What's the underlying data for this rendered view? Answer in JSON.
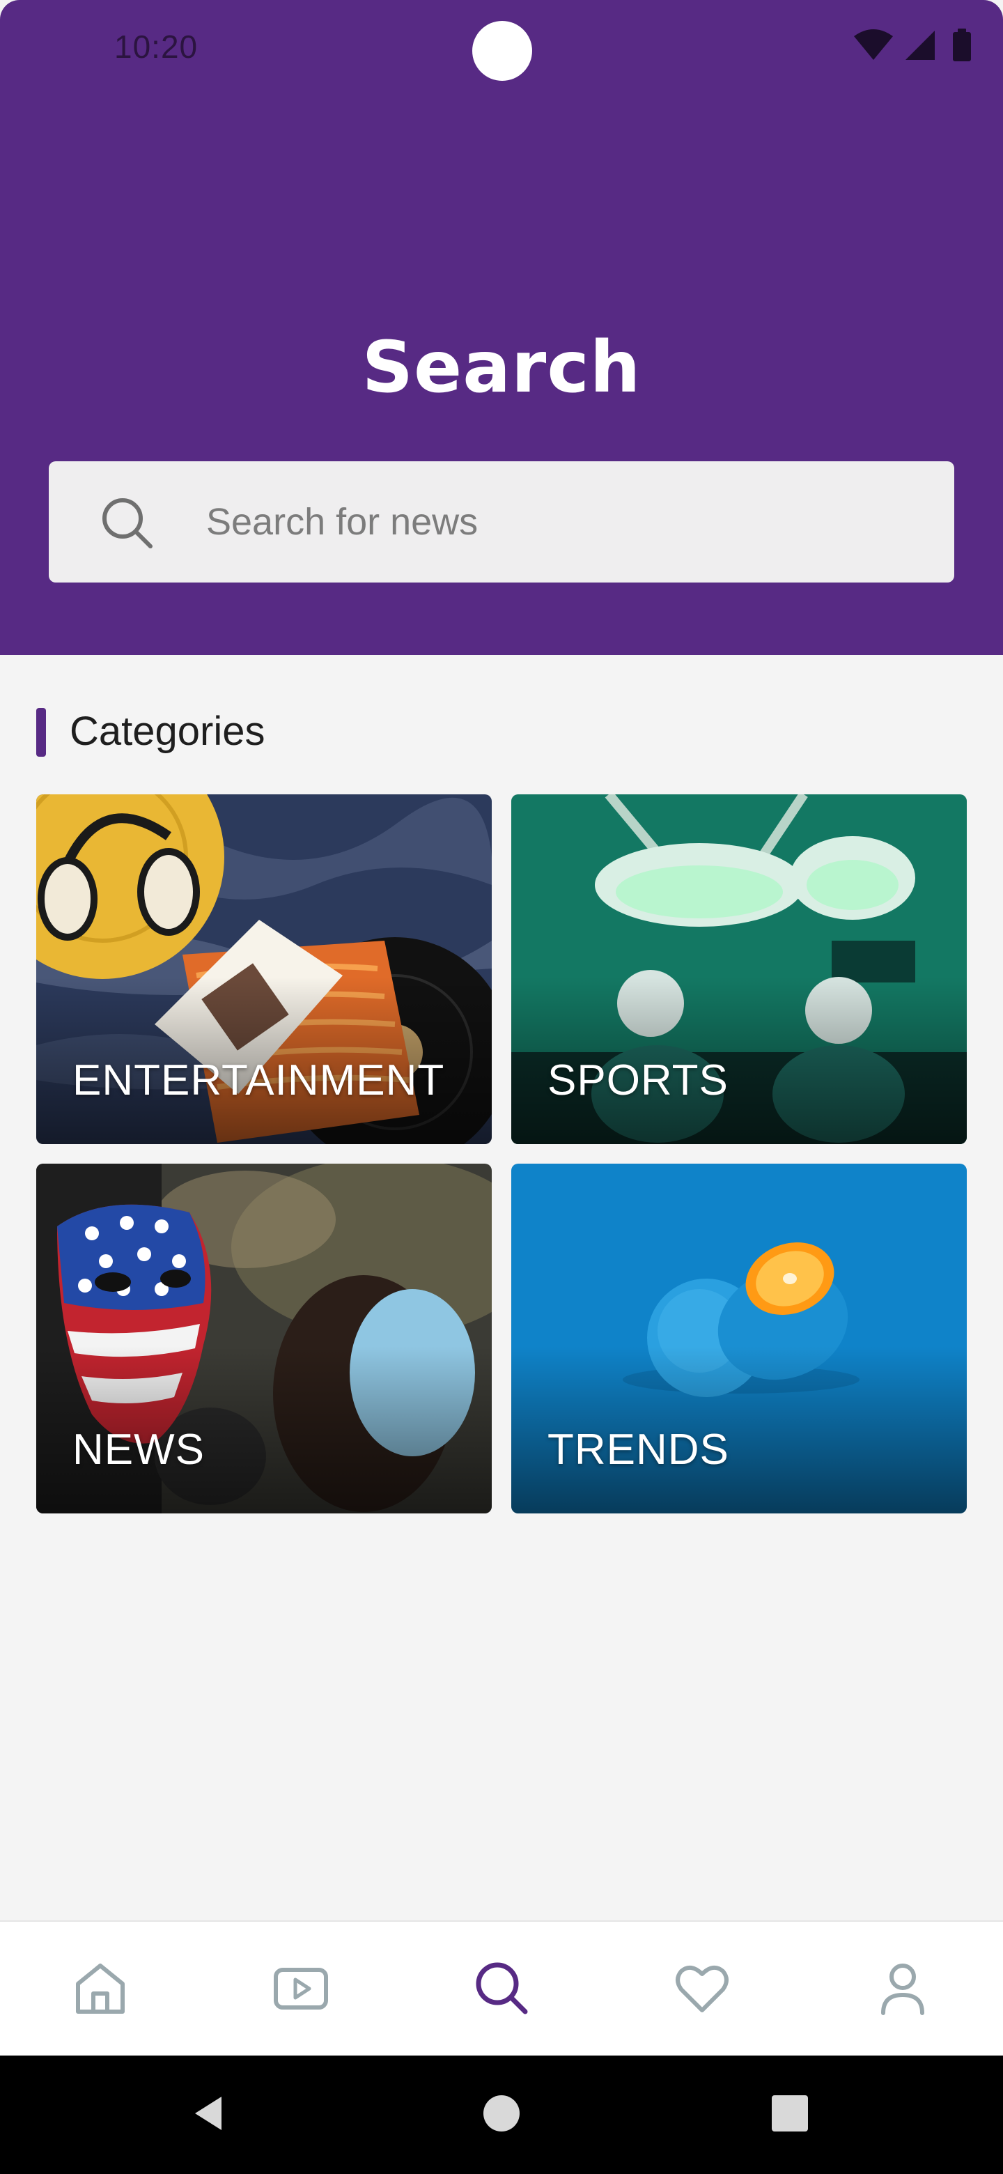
{
  "status_bar": {
    "time": "10:20"
  },
  "header": {
    "title": "Search",
    "background_color": "#572a84"
  },
  "search": {
    "placeholder": "Search for news",
    "value": "",
    "icon": "search-icon"
  },
  "categories": {
    "title": "Categories",
    "items": [
      {
        "label": "ENTERTAINMENT"
      },
      {
        "label": "SPORTS"
      },
      {
        "label": "NEWS"
      },
      {
        "label": "TRENDS"
      }
    ]
  },
  "bottom_nav": {
    "items": [
      {
        "icon": "home-icon",
        "active": false
      },
      {
        "icon": "video-icon",
        "active": false
      },
      {
        "icon": "search-icon",
        "active": true
      },
      {
        "icon": "heart-icon",
        "active": false
      },
      {
        "icon": "profile-icon",
        "active": false
      }
    ],
    "active_color": "#572a84",
    "inactive_color": "#9aa8ad"
  }
}
